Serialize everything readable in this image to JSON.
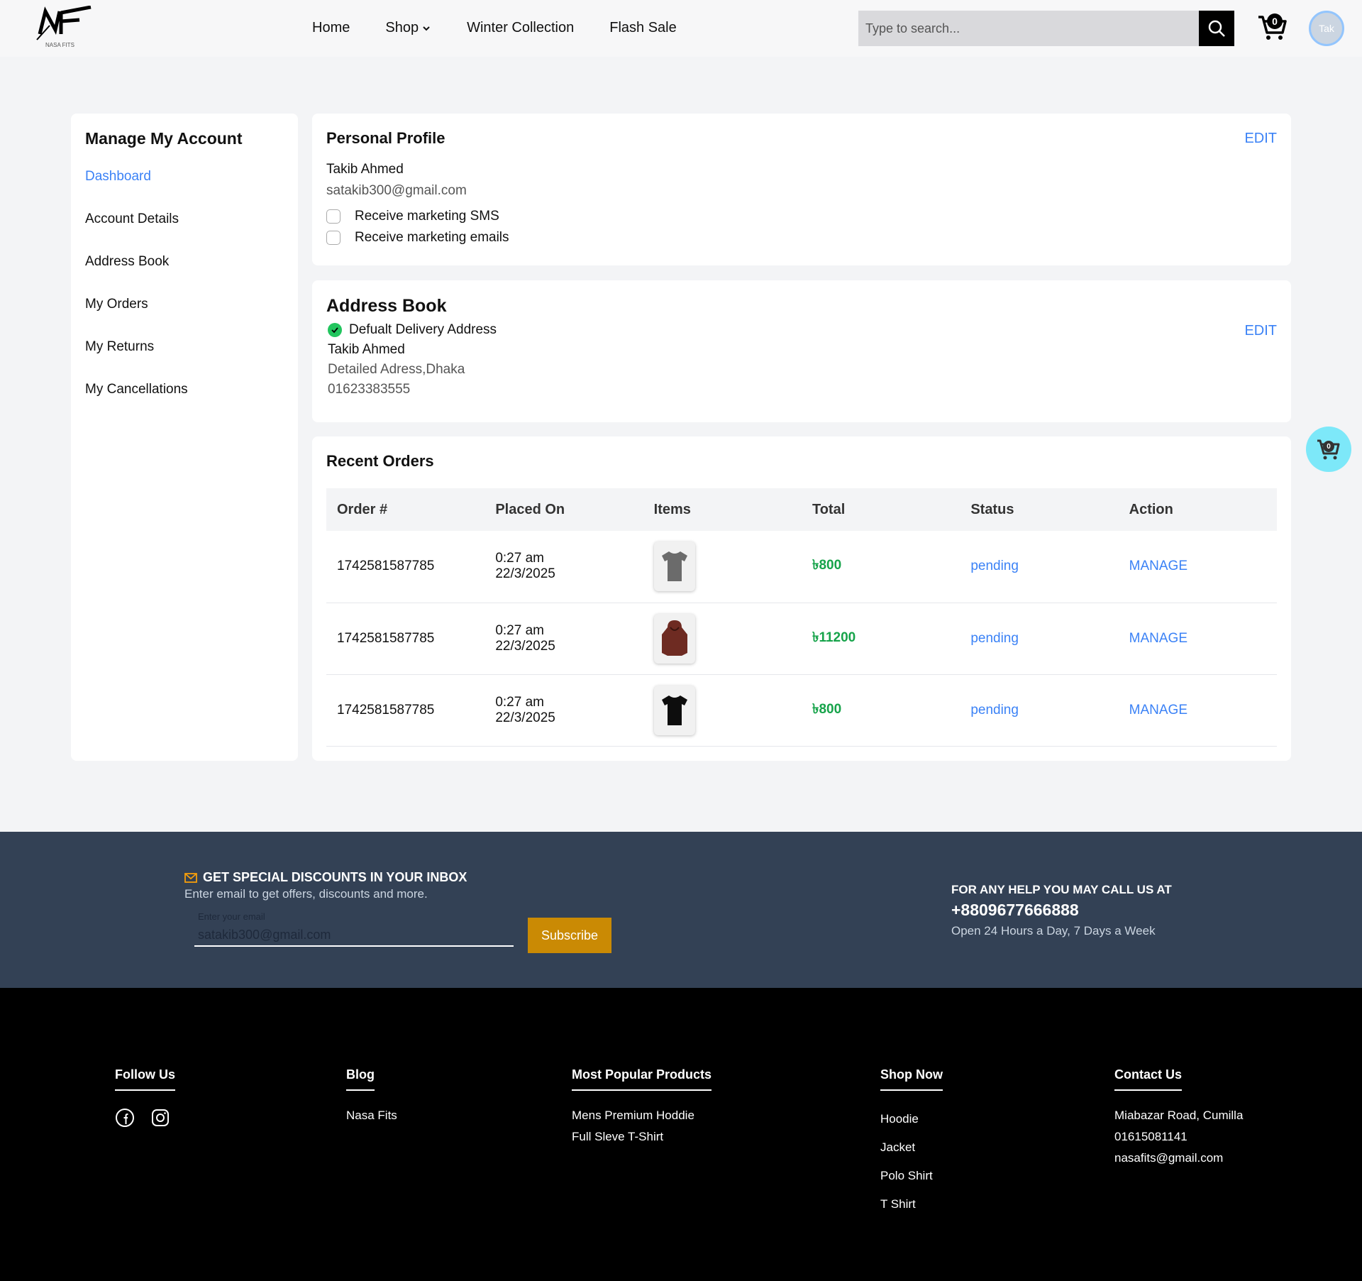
{
  "header": {
    "logo_text": "NASA FITS",
    "nav": [
      "Home",
      "Shop",
      "Winter Collection",
      "Flash Sale"
    ],
    "search_placeholder": "Type to search...",
    "cart_count": "0",
    "avatar_text": "Tak"
  },
  "sidebar": {
    "title": "Manage My Account",
    "items": [
      "Dashboard",
      "Account Details",
      "Address Book",
      "My Orders",
      "My Returns",
      "My Cancellations"
    ]
  },
  "profile": {
    "title": "Personal Profile",
    "edit": "EDIT",
    "name": "Takib Ahmed",
    "email": "satakib300@gmail.com",
    "options": [
      "Receive marketing SMS",
      "Receive marketing emails"
    ]
  },
  "address": {
    "title": "Address Book",
    "edit": "EDIT",
    "default_label": "Defualt Delivery Address",
    "name": "Takib Ahmed",
    "detail": "Detailed Adress,Dhaka",
    "phone": "01623383555"
  },
  "orders": {
    "title": "Recent Orders",
    "columns": [
      "Order #",
      "Placed On",
      "Items",
      "Total",
      "Status",
      "Action"
    ],
    "rows": [
      {
        "id": "1742581587785",
        "time": "0:27 am",
        "date": "22/3/2025",
        "item": "grey-tshirt",
        "total": "৳800",
        "status": "pending",
        "action": "MANAGE"
      },
      {
        "id": "1742581587785",
        "time": "0:27 am",
        "date": "22/3/2025",
        "item": "brown-hoodie",
        "total": "৳11200",
        "status": "pending",
        "action": "MANAGE"
      },
      {
        "id": "1742581587785",
        "time": "0:27 am",
        "date": "22/3/2025",
        "item": "black-tshirt",
        "total": "৳800",
        "status": "pending",
        "action": "MANAGE"
      }
    ]
  },
  "floating_cart_count": "0",
  "newsletter": {
    "title": "GET SPECIAL DISCOUNTS IN YOUR INBOX",
    "subtitle": "Enter email to get offers, discounts and more.",
    "input_label": "Enter your email",
    "input_value": "satakib300@gmail.com",
    "button": "Subscribe",
    "help_title": "FOR ANY HELP YOU MAY CALL US AT",
    "help_phone": "+8809677666888",
    "help_hours": "Open 24 Hours a Day, 7 Days a Week"
  },
  "footer": {
    "follow": "Follow Us",
    "blog": {
      "title": "Blog",
      "links": [
        "Nasa Fits"
      ]
    },
    "popular": {
      "title": "Most Popular Products",
      "links": [
        "Mens Premium Hoddie",
        "Full Sleve T-Shirt"
      ]
    },
    "shop": {
      "title": "Shop Now",
      "links": [
        "Hoodie",
        "Jacket",
        "Polo Shirt",
        "T Shirt"
      ]
    },
    "contact": {
      "title": "Contact Us",
      "lines": [
        "Miabazar Road, Cumilla",
        "01615081141",
        "nasafits@gmail.com"
      ]
    }
  },
  "colors": {
    "accent": "#3b82f6",
    "price": "#16a34a",
    "subscribe": "#ca8a04",
    "newsletter_bg": "#334155"
  }
}
